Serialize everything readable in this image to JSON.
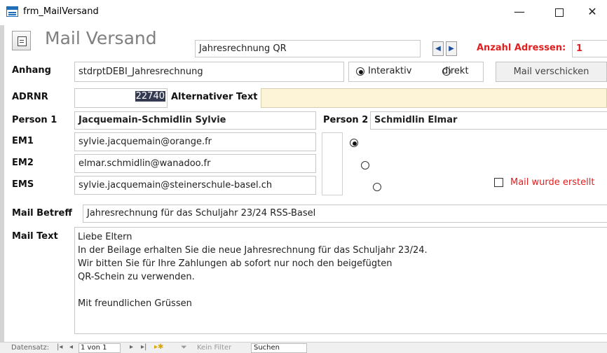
{
  "window": {
    "title": "frm_MailVersand",
    "minimize_glyph": "—",
    "close_glyph": "✕"
  },
  "form": {
    "title": "Mail Versand",
    "rechnung_value": "Jahresrechnung QR",
    "nav_prev_glyph": "◀",
    "nav_next_glyph": "▶",
    "anzahl_label": "Anzahl Adressen:",
    "anzahl_value": "1"
  },
  "anhang": {
    "label": "Anhang",
    "value": "stdrptDEBI_Jahresrechnung",
    "mode_interaktiv": "Interaktiv",
    "mode_direkt": "direkt",
    "selected_mode": "Interaktiv",
    "send_button": "Mail verschicken"
  },
  "adrnr": {
    "label": "ADRNR",
    "value": "22740",
    "alt_text_label": "Alternativer Text",
    "alt_text_value": ""
  },
  "persons": {
    "person1_label": "Person 1",
    "person1_value": "Jacquemain-Schmidlin Sylvie",
    "person2_label": "Person 2",
    "person2_value": "Schmidlin Elmar"
  },
  "emails": {
    "em1_label": "EM1",
    "em1_value": "sylvie.jacquemain@orange.fr",
    "em2_label": "EM2",
    "em2_value": "elmar.schmidlin@wanadoo.fr",
    "ems_label": "EMS",
    "ems_value": "sylvie.jacquemain@steinerschule-basel.ch",
    "selected": "EM1"
  },
  "mail_created": {
    "label": "Mail wurde erstellt",
    "checked": false
  },
  "betreff": {
    "label": "Mail Betreff",
    "value": "Jahresrechnung für das Schuljahr 23/24 RSS-Basel"
  },
  "mailtext": {
    "label": "Mail Text",
    "lines": [
      "Liebe Eltern",
      "In der Beilage erhalten Sie die neue Jahresrechnung für das Schuljahr 23/24.",
      "Wir bitten Sie für Ihre Zahlungen ab sofort nur noch den beigefügten",
      "QR-Schein zu verwenden.",
      "",
      "Mit freundlichen Grüssen"
    ]
  },
  "record_nav": {
    "label": "Datensatz:",
    "first_glyph": "|◂",
    "prev_glyph": "◂",
    "position": "1 von 1",
    "next_glyph": "▸",
    "last_glyph": "▸|",
    "new_glyph": "▸✱",
    "filter_label": "Kein Filter",
    "filter_glyph": "⏷",
    "search_value": "Suchen"
  },
  "colors": {
    "accent_red": "#e02020",
    "alt_text_bg": "#fdf3d6",
    "title_gray": "#7f7f7f"
  }
}
